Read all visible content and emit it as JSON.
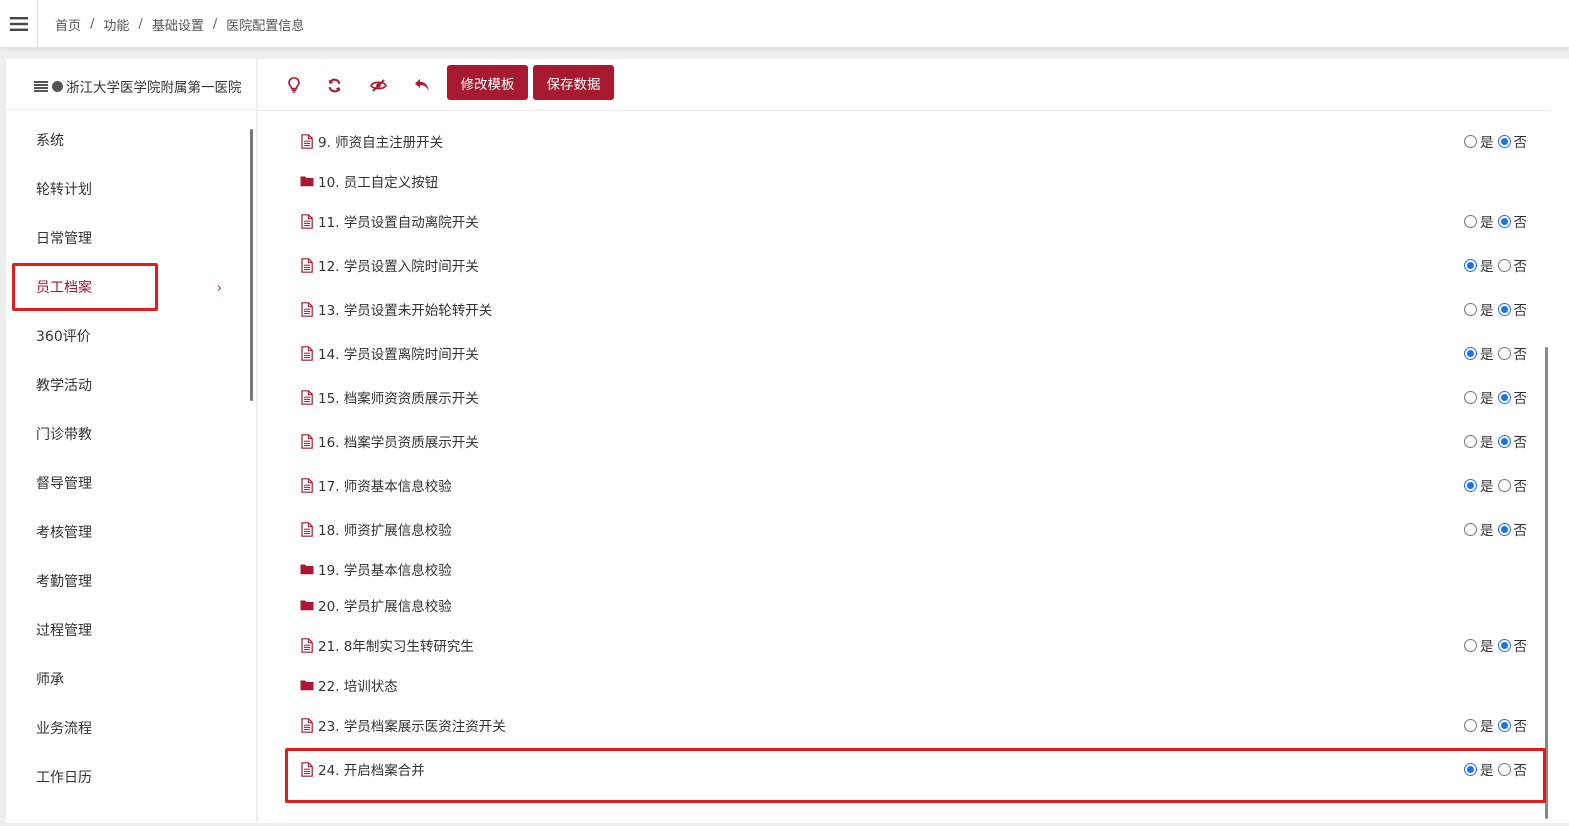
{
  "breadcrumb": [
    "首页",
    "功能",
    "基础设置",
    "医院配置信息"
  ],
  "sidebar": {
    "hospital": "浙江大学医学院附属第一医院",
    "items": [
      {
        "label": "系统"
      },
      {
        "label": "轮转计划"
      },
      {
        "label": "日常管理"
      },
      {
        "label": "员工档案",
        "active": true
      },
      {
        "label": "360评价"
      },
      {
        "label": "教学活动"
      },
      {
        "label": "门诊带教"
      },
      {
        "label": "督导管理"
      },
      {
        "label": "考核管理"
      },
      {
        "label": "考勤管理"
      },
      {
        "label": "过程管理"
      },
      {
        "label": "师承"
      },
      {
        "label": "业务流程"
      },
      {
        "label": "工作日历"
      }
    ]
  },
  "toolbar": {
    "icons": [
      "lightbulb-icon",
      "refresh-icon",
      "eye-off-icon",
      "undo-icon"
    ],
    "edit_template": "修改模板",
    "save_data": "保存数据"
  },
  "radio_labels": {
    "yes": "是",
    "no": "否"
  },
  "colors": {
    "brand": "#a6192e",
    "radio": "#1a73e8",
    "highlight": "#e31b1b"
  },
  "settings": [
    {
      "label": "9. 师资自主注册开关",
      "type": "item",
      "value": "no"
    },
    {
      "label": "10. 员工自定义按钮",
      "type": "folder"
    },
    {
      "label": "11. 学员设置自动离院开关",
      "type": "item",
      "value": "no"
    },
    {
      "label": "12. 学员设置入院时间开关",
      "type": "item",
      "value": "yes"
    },
    {
      "label": "13. 学员设置未开始轮转开关",
      "type": "item",
      "value": "no"
    },
    {
      "label": "14. 学员设置离院时间开关",
      "type": "item",
      "value": "yes"
    },
    {
      "label": "15. 档案师资资质展示开关",
      "type": "item",
      "value": "no"
    },
    {
      "label": "16. 档案学员资质展示开关",
      "type": "item",
      "value": "no"
    },
    {
      "label": "17. 师资基本信息校验",
      "type": "item",
      "value": "yes"
    },
    {
      "label": "18. 师资扩展信息校验",
      "type": "item",
      "value": "no"
    },
    {
      "label": "19. 学员基本信息校验",
      "type": "folder"
    },
    {
      "label": "20. 学员扩展信息校验",
      "type": "folder"
    },
    {
      "label": "21. 8年制实习生转研究生",
      "type": "item",
      "value": "no"
    },
    {
      "label": "22. 培训状态",
      "type": "folder"
    },
    {
      "label": "23. 学员档案展示医资注资开关",
      "type": "item",
      "value": "no"
    },
    {
      "label": "24. 开启档案合并",
      "type": "item",
      "value": "yes"
    }
  ]
}
